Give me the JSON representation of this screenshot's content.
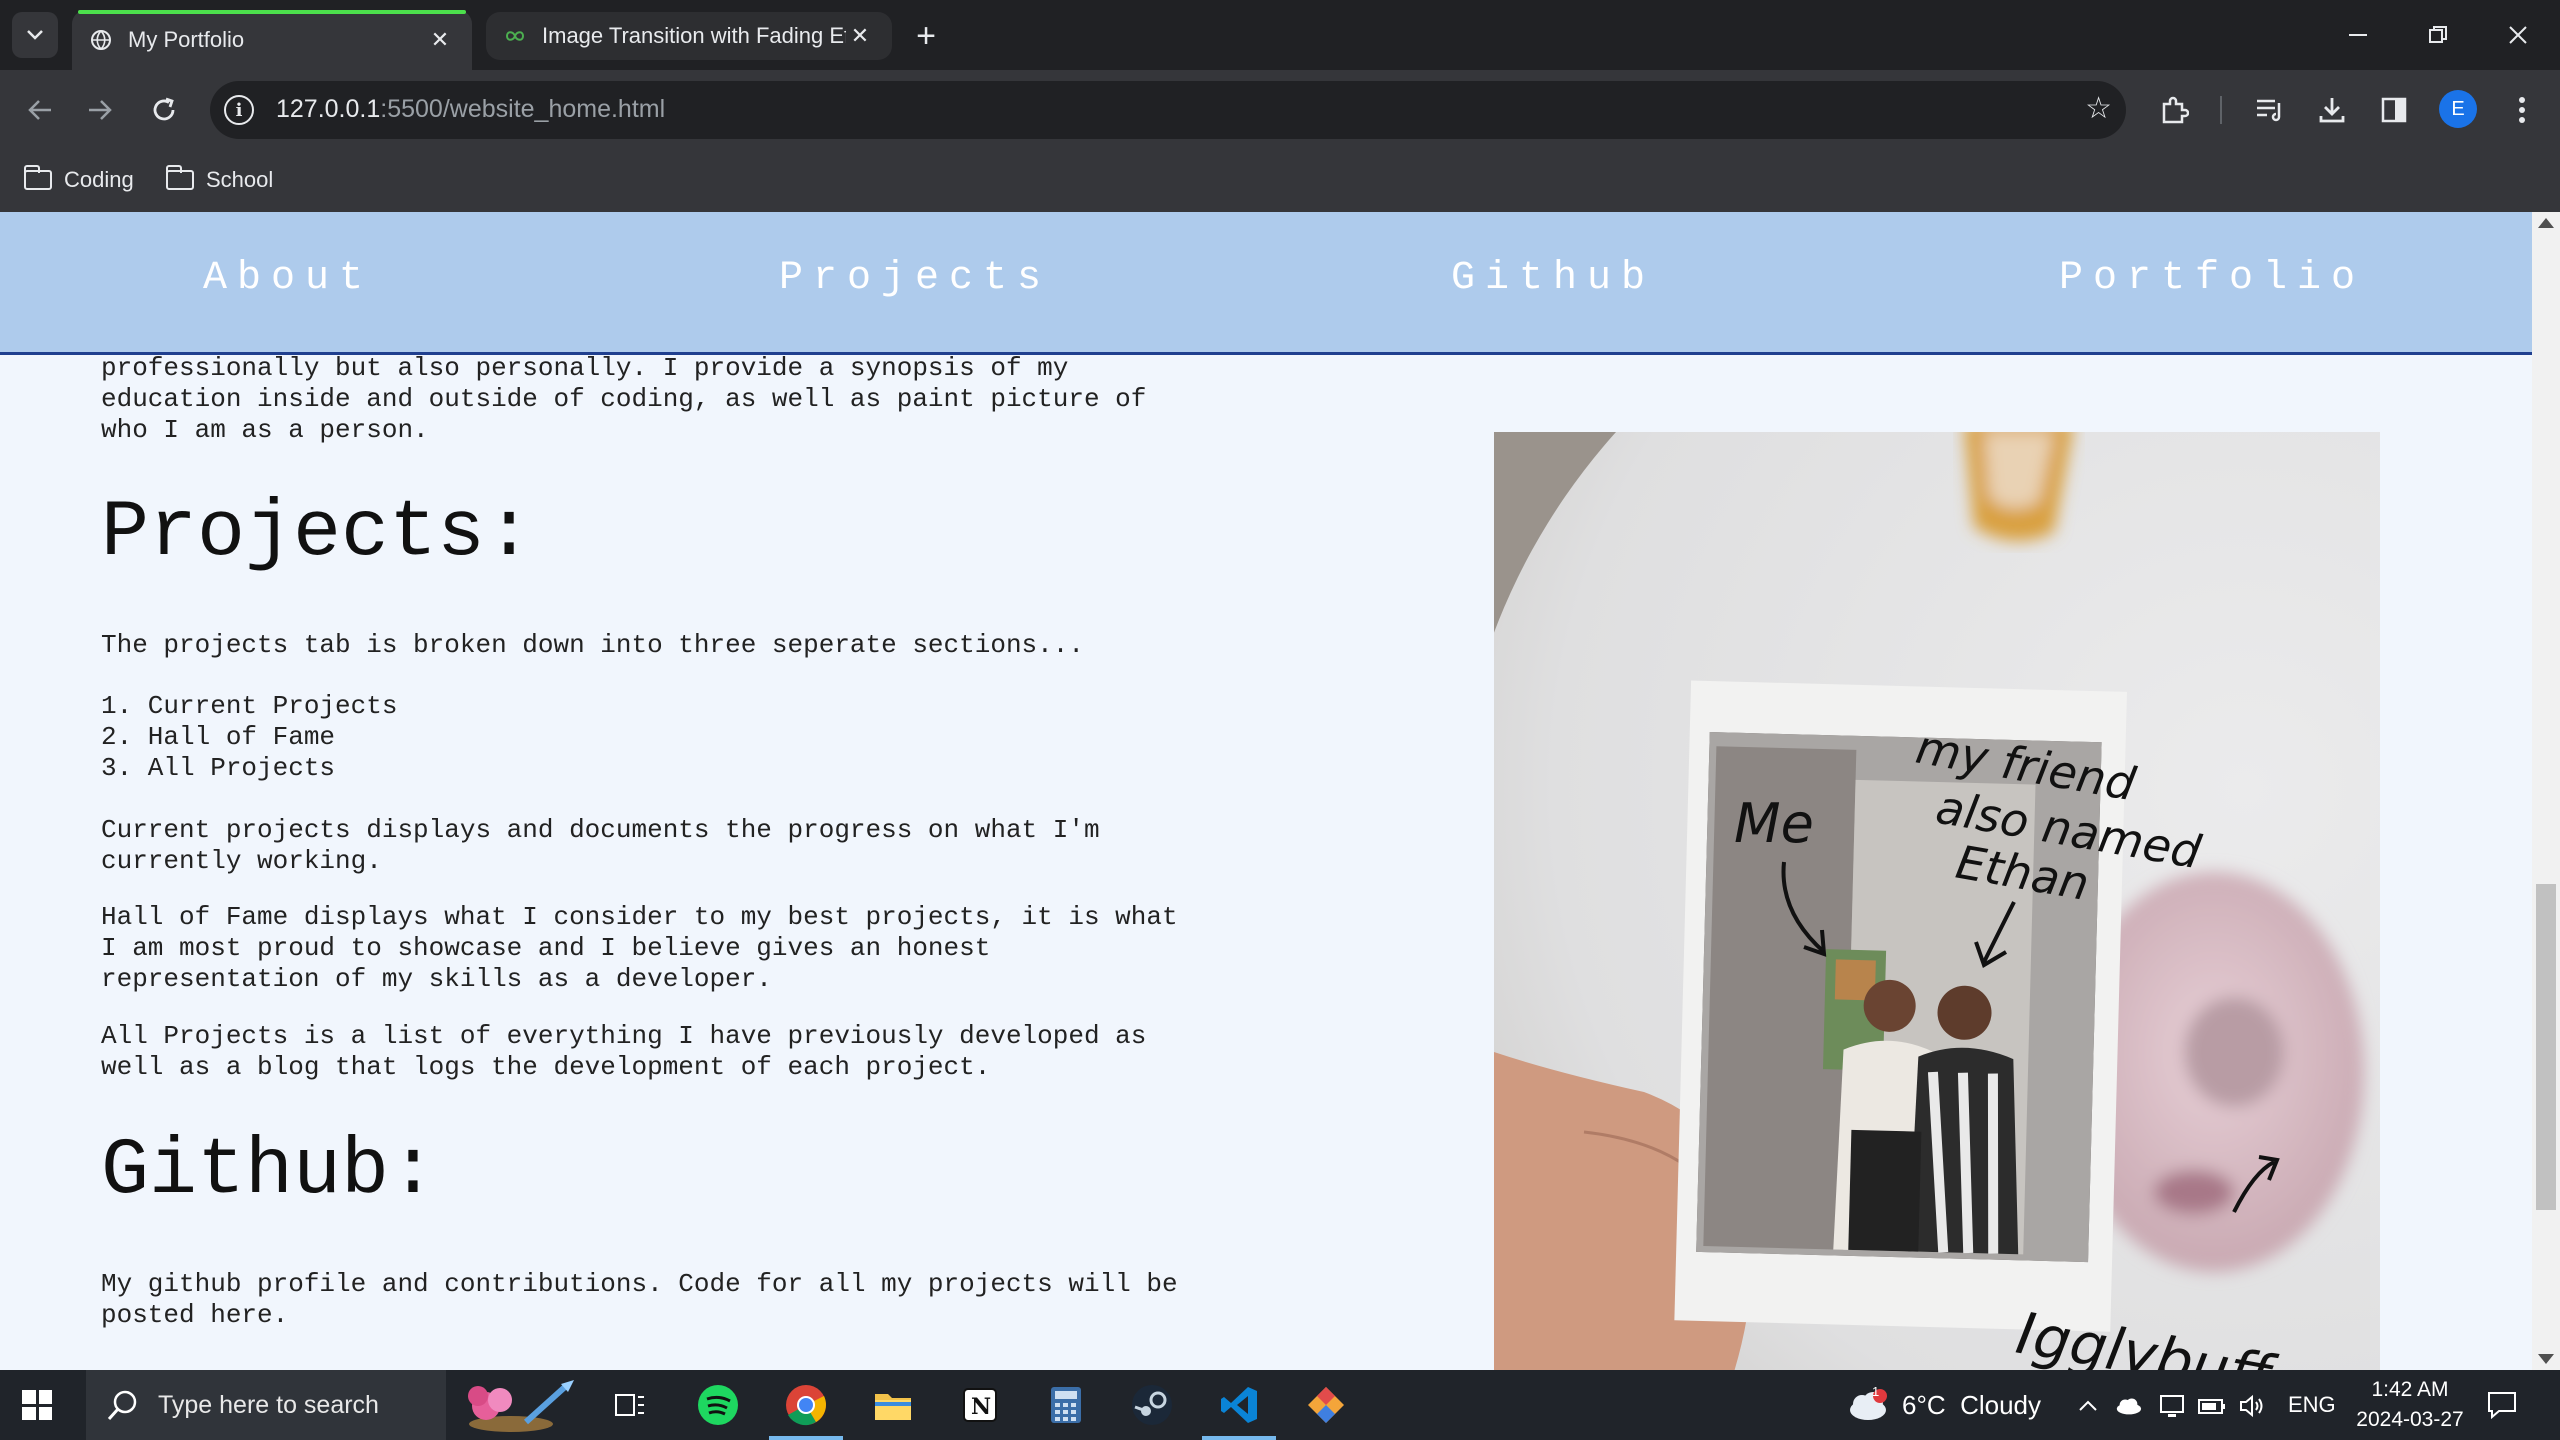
{
  "browser": {
    "tabs": [
      {
        "title": "My Portfolio",
        "active": true
      },
      {
        "title": "Image Transition with Fading Ef",
        "active": false
      }
    ],
    "url_host": "127.0.0.1",
    "url_path": ":5500/website_home.html",
    "profile_initial": "E",
    "bookmarks": [
      "Coding",
      "School"
    ]
  },
  "site": {
    "nav": [
      "About",
      "Projects",
      "Github",
      "Portfolio"
    ],
    "intro_text": "professionally but also personally. I provide a synopsis of my\neducation inside and outside of coding, as well as paint picture of\nwho I am as a person.",
    "projects_heading": "Projects:",
    "projects_intro": "The projects tab is broken down into three seperate sections...",
    "projects_list": "1. Current Projects\n2. Hall of Fame\n3. All Projects",
    "current_projects_text": "Current projects displays and documents the progress on what I'm\ncurrently working.",
    "hall_of_fame_text": "Hall of Fame displays what I consider to my best projects, it is what\nI am most proud to showcase and I believe gives an honest\nrepresentation of my skills as a developer.",
    "all_projects_text": "All Projects is a list of everything I have previously developed as\nwell as a blog that logs the development of each project.",
    "github_heading": "Github:",
    "github_text": "My github profile and contributions. Code for all my projects will be\nposted here.",
    "photo_annotations": {
      "me": "Me",
      "friend_line1": "my friend",
      "friend_line2": "also named",
      "friend_line3": "Ethan",
      "plush": "Igglybuff"
    }
  },
  "taskbar": {
    "search_placeholder": "Type here to search",
    "weather": "6°C  Cloudy",
    "weather_badge": "1",
    "language": "ENG",
    "time": "1:42 AM",
    "date": "2024-03-27"
  },
  "colors": {
    "nav_bg": "#aecbec",
    "nav_border": "#1f3f8f",
    "page_bg": "#f1f6fd",
    "tab_accent": "#4ce04c"
  }
}
